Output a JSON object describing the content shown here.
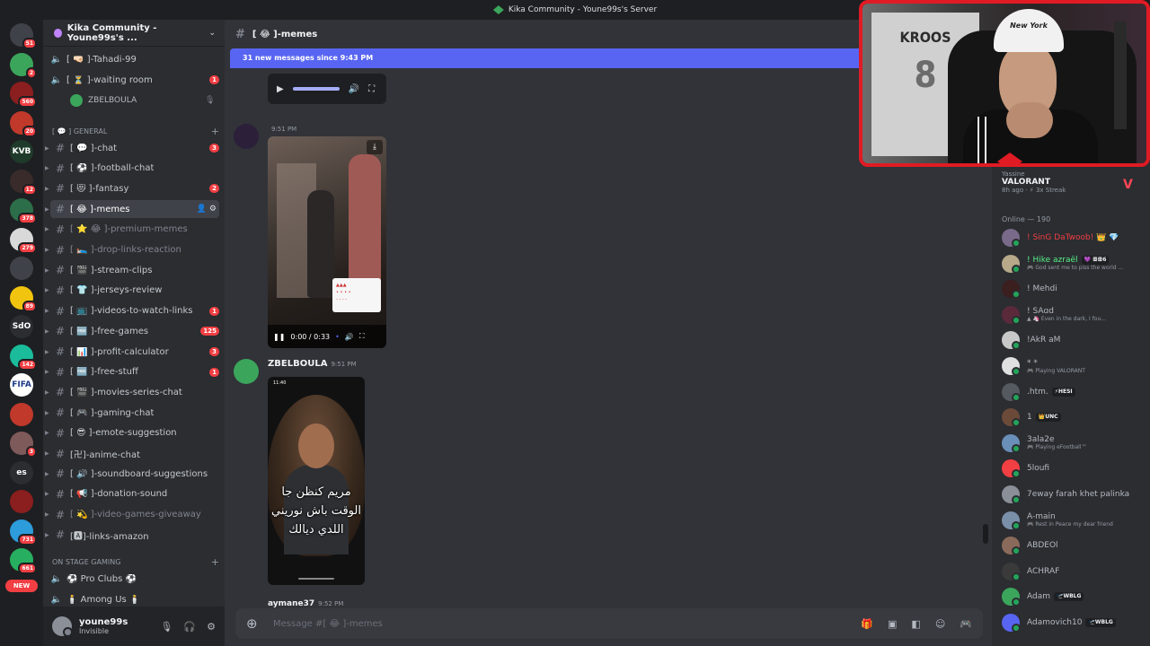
{
  "window": {
    "title": "Kika Community - Youne99s's Server"
  },
  "rail": {
    "servers": [
      {
        "name": "discord-home",
        "label": "",
        "badge": "51",
        "color": "#404249"
      },
      {
        "name": "server-2",
        "label": "",
        "badge": "2",
        "color": "#3ba55c"
      },
      {
        "name": "server-3",
        "label": "",
        "badge": "560",
        "color": "#8b1e1e"
      },
      {
        "name": "server-4",
        "label": "",
        "badge": "20",
        "color": "#c0392b"
      },
      {
        "name": "server-kvb",
        "label": "KVB",
        "badge": "",
        "color": "#1f3a2a"
      },
      {
        "name": "server-6",
        "label": "",
        "badge": "12",
        "color": "#3a2b2b"
      },
      {
        "name": "server-7",
        "label": "",
        "badge": "378",
        "color": "#2c6e49"
      },
      {
        "name": "server-8",
        "label": "",
        "badge": "279",
        "color": "#d9d9d9"
      },
      {
        "name": "server-9",
        "label": "",
        "badge": "",
        "color": "#404249"
      },
      {
        "name": "server-10",
        "label": "",
        "badge": "89",
        "color": "#f1c40f"
      },
      {
        "name": "server-sdo",
        "label": "SdO",
        "badge": "",
        "color": "#2b2d31"
      },
      {
        "name": "server-12",
        "label": "",
        "badge": "142",
        "color": "#1abc9c"
      },
      {
        "name": "server-fifa",
        "label": "FIFA",
        "badge": "",
        "color": "#ffffff"
      },
      {
        "name": "server-14",
        "label": "",
        "badge": "",
        "color": "#c0392b"
      },
      {
        "name": "server-15",
        "label": "",
        "badge": "3",
        "color": "#7f5a5a"
      },
      {
        "name": "server-es",
        "label": "es",
        "badge": "",
        "color": "#2b2d31"
      },
      {
        "name": "server-17",
        "label": "",
        "badge": "",
        "color": "#8b1e1e"
      },
      {
        "name": "server-18",
        "label": "",
        "badge": "731",
        "color": "#2d9cdb"
      },
      {
        "name": "server-19",
        "label": "",
        "badge": "661",
        "color": "#27ae60"
      }
    ],
    "new_label": "NEW"
  },
  "sidebar": {
    "server_name": "Kika Community - Youne99s's ...",
    "top_channels": [
      {
        "label": "[ 🤜🏻 ]-Tahadi-99",
        "badge": ""
      },
      {
        "label": "[ ⏳ ]-waiting room",
        "badge": "1"
      }
    ],
    "voice_user": "ZBELBOULA",
    "category_general": "[ 💬 ] GENERAL",
    "channels": [
      {
        "label": "[ 💬 ]-chat",
        "badge": "3",
        "muted": false
      },
      {
        "label": "[ ⚽ ]-football-chat",
        "badge": "",
        "muted": false
      },
      {
        "label": "[ 😻 ]-fantasy",
        "badge": "2",
        "muted": false
      },
      {
        "label": "[ 😂 ]-memes",
        "badge": "",
        "muted": false
      },
      {
        "label": "[ ⭐ 😂 ]-premium-memes",
        "badge": "",
        "muted": true
      },
      {
        "label": "[ 🛌 ]-drop-links-reaction",
        "badge": "",
        "muted": true
      },
      {
        "label": "[ 🎬 ]-stream-clips",
        "badge": "",
        "muted": false
      },
      {
        "label": "[ 👕 ]-jerseys-review",
        "badge": "",
        "muted": false
      },
      {
        "label": "[ 📺 ]-videos-to-watch-links",
        "badge": "1",
        "muted": false
      },
      {
        "label": "[ 🆓 ]-free-games",
        "badge": "125",
        "muted": false
      },
      {
        "label": "[ 📊 ]-profit-calculator",
        "badge": "3",
        "muted": false
      },
      {
        "label": "[ 🆓 ]-free-stuff",
        "badge": "1",
        "muted": false
      },
      {
        "label": "[ 🎬 ]-movies-series-chat",
        "badge": "",
        "muted": false
      },
      {
        "label": "[ 🎮 ]-gaming-chat",
        "badge": "",
        "muted": false
      },
      {
        "label": "[ 😎 ]-emote-suggestion",
        "badge": "",
        "muted": false
      },
      {
        "label": "[卍]-anime-chat",
        "badge": "",
        "muted": false
      },
      {
        "label": "[ 🔊 ]-soundboard-suggestions",
        "badge": "",
        "muted": false
      },
      {
        "label": "[ 📢 ]-donation-sound",
        "badge": "",
        "muted": false
      },
      {
        "label": "[ 💫 ]-video-games-giveaway",
        "badge": "",
        "muted": true
      },
      {
        "label": "[🅰]-links-amazon",
        "badge": "",
        "muted": false
      }
    ],
    "category_stage": "On Stage Gaming",
    "stage_channels": [
      {
        "label": "⚽ Pro Clubs ⚽"
      },
      {
        "label": "🕯️ Among Us 🕯️"
      }
    ],
    "user": {
      "name": "youne99s",
      "status": "Invisible"
    }
  },
  "chat": {
    "channel_name": "[ 😂 ]-memes",
    "new_banner": "31 new messages since 9:43 PM",
    "msg1": {
      "author": "",
      "time": "9:51 PM",
      "video_time": "0:00 / 0:33"
    },
    "msg2": {
      "author": "ZBELBOULA",
      "time": "9:51 PM",
      "phone_time": "11:40",
      "caption": "مريم كنظن جا الوقت باش نوريني اللدي ديالك"
    },
    "next_author": "aymane37",
    "next_time": "9:52 PM",
    "composer_placeholder": "Message #[ 😂 ]-memes"
  },
  "webcam": {
    "jersey_text": "KROOS",
    "jersey_number": "8",
    "cap_text": "New York"
  },
  "members": {
    "activity": {
      "user": "Yassine",
      "game": "VALORANT",
      "ago": "8h ago · ⚡ 3x Streak"
    },
    "online_header": "Online — 190",
    "list": [
      {
        "name": "! SinG DaTwoob! 👑 💎",
        "status": "",
        "color": "#f23f43",
        "av": "#7a6a8a",
        "tag": ""
      },
      {
        "name": "! Hike azraël",
        "status": "🎮 God sent me to piss the world ...",
        "color": "#57f287",
        "av": "#b7a98a",
        "tag": "💜 ꕥꕥ6"
      },
      {
        "name": "! Mehdi",
        "status": "",
        "color": "#b5bac1",
        "av": "#3b1e1e",
        "tag": ""
      },
      {
        "name": "! SAɑd",
        "status": "▲ 🦄 Even in the dark, I fou...",
        "color": "#b5bac1",
        "av": "#5a2a3a",
        "tag": ""
      },
      {
        "name": "!AkR aM",
        "status": "",
        "color": "#b5bac1",
        "av": "#c8c8c8",
        "tag": ""
      },
      {
        "name": "* *",
        "status": "🎮 Playing VALORANT",
        "color": "#b5bac1",
        "av": "#e0e0e0",
        "tag": ""
      },
      {
        "name": ".htm.",
        "status": "",
        "color": "#b5bac1",
        "av": "#555a60",
        "tag": "⚡HESI"
      },
      {
        "name": "1",
        "status": "",
        "color": "#b5bac1",
        "av": "#6b4a3a",
        "tag": "👑UNC"
      },
      {
        "name": "3ala2e",
        "status": "🎮 Playing eFootball™",
        "color": "#b5bac1",
        "av": "#6a8fb8",
        "tag": ""
      },
      {
        "name": "5loufi",
        "status": "",
        "color": "#b5bac1",
        "av": "#f23f43",
        "tag": ""
      },
      {
        "name": "7eway farah khet palinka",
        "status": "",
        "color": "#b5bac1",
        "av": "#8a8f98",
        "tag": ""
      },
      {
        "name": "A-main",
        "status": "🎮 Rest in Peace my dear friend",
        "color": "#b5bac1",
        "av": "#7a8fa8",
        "tag": ""
      },
      {
        "name": "ABDEOl",
        "status": "",
        "color": "#b5bac1",
        "av": "#8a6a5a",
        "tag": ""
      },
      {
        "name": "ACHRAF",
        "status": "",
        "color": "#b5bac1",
        "av": "#3a3a3a",
        "tag": ""
      },
      {
        "name": "Adam",
        "status": "",
        "color": "#b5bac1",
        "av": "#3ba55c",
        "tag": "🛫WBLG"
      },
      {
        "name": "Adamovich10",
        "status": "",
        "color": "#b5bac1",
        "av": "#5865f2",
        "tag": "🛫WBLG"
      }
    ]
  }
}
